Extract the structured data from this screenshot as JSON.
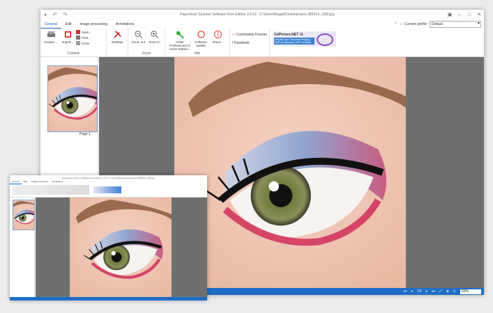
{
  "window": {
    "title": "PaperScan Scanner Software Free Edition 3.0.12 - C:\\Users\\Magali\\Desktop\\eyes-385514_1280.jpg",
    "title_short": "PaperScan Scanner Software Free Edition 3.0.12 - C:\\Users\\Magali\\Desktop\\eyes-385514_1280.jpg"
  },
  "tabs": [
    "General",
    "Edit",
    "Image processing",
    "Annotations"
  ],
  "profile": {
    "label": "Current profile:",
    "value": "Default"
  },
  "ribbon": {
    "acquire": "Acquire ...",
    "import": "Import...",
    "save": "Save...",
    "print": "Print...",
    "close": "Close",
    "content_label": "Content",
    "settings": "Settings",
    "zoom_out": "Zoom out",
    "zoom_in": "Zoom in",
    "zoom_label": "Zoom",
    "order": "Order Professional or Home Edition...",
    "update": "Software update",
    "about": "About...",
    "info_label": "Info",
    "forums": "Community Forums",
    "facebook": "Facebook",
    "promo_title": "GdPicture.NET 11",
    "promo_sub": "Simplify Your Document Imaging SDK for Windows, WPF and Web"
  },
  "thumbnail": {
    "page_label": "Page 1"
  },
  "status": {
    "page": "1/1",
    "zoom": "50%"
  },
  "colors": {
    "accent": "#1e6ec8",
    "tab_active": "#1e5fb4"
  }
}
